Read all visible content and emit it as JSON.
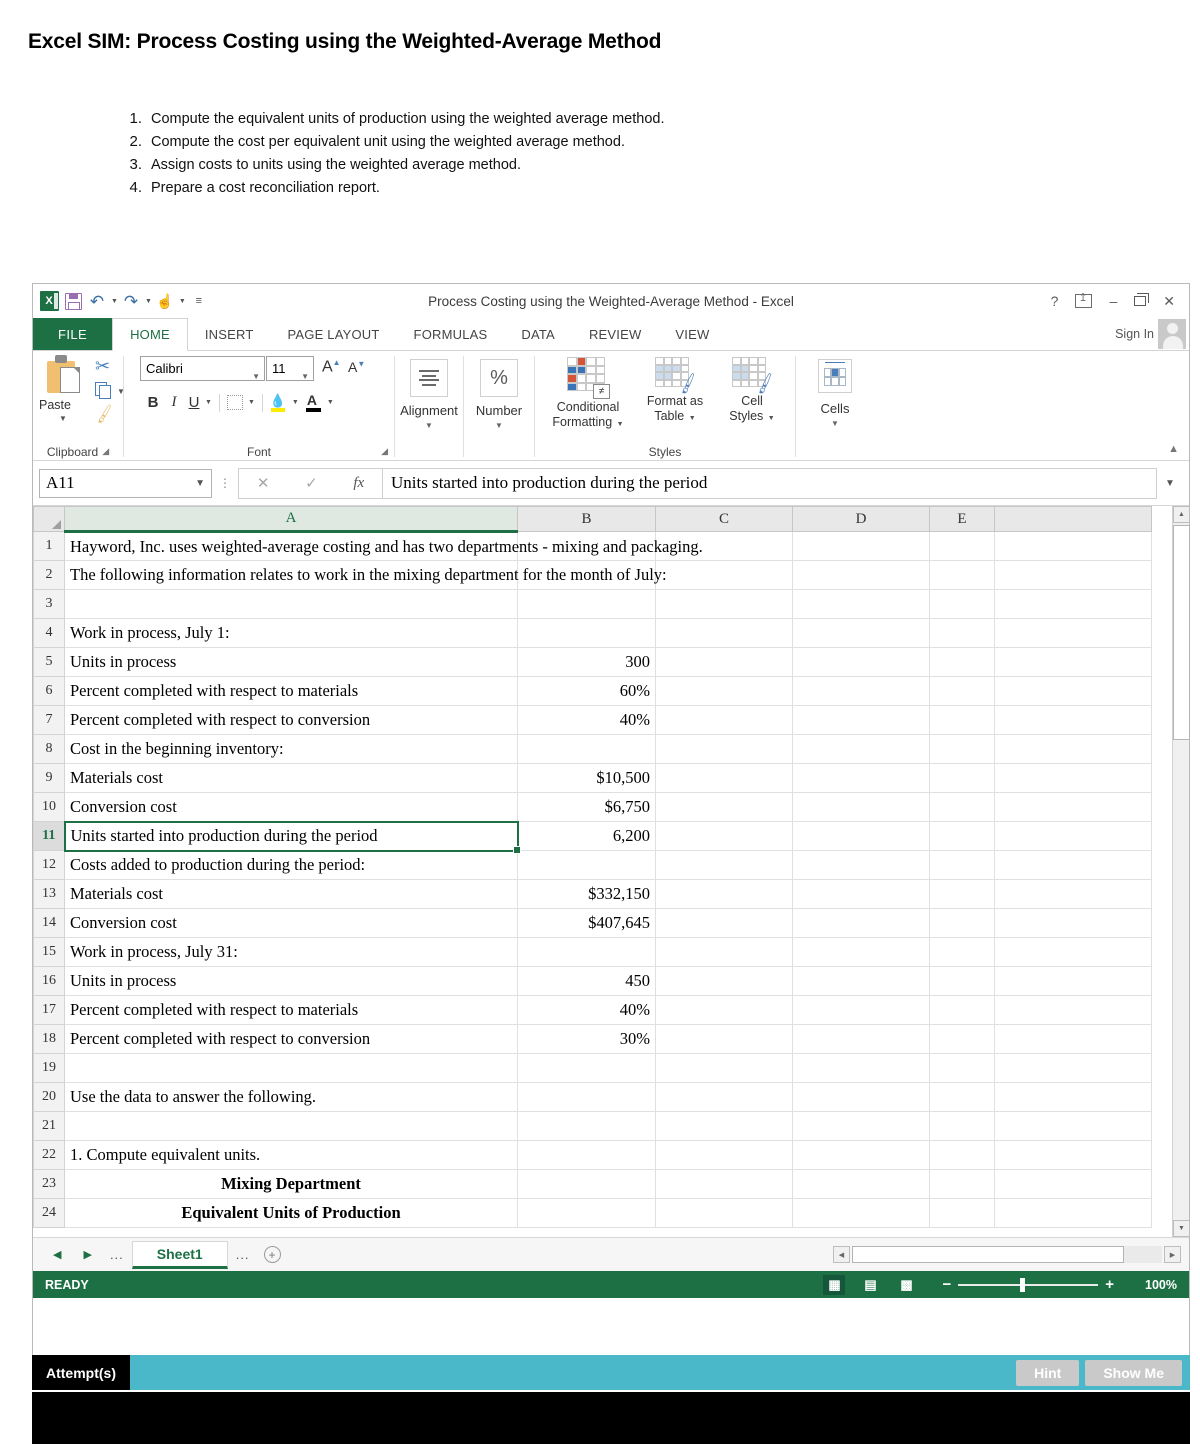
{
  "page": {
    "title": "Excel SIM: Process Costing using the Weighted-Average Method",
    "tasks": [
      {
        "num": "1.",
        "text": "Compute the equivalent units of production using the weighted average method."
      },
      {
        "num": "2.",
        "text": "Compute the cost per equivalent unit using the weighted average method."
      },
      {
        "num": "3.",
        "text": "Assign costs to units using the weighted average method."
      },
      {
        "num": "4.",
        "text": "Prepare a cost reconciliation report."
      }
    ]
  },
  "window": {
    "title": "Process Costing using the Weighted-Average Method - Excel",
    "quick_access": {
      "logo": "excel-logo",
      "save": "save-icon",
      "undo": "undo-icon",
      "redo": "redo-icon",
      "touch": "touch-mode-icon",
      "more": "more-icon"
    },
    "controls": {
      "help": "?",
      "ribbon_options": "ribbon-display-options-icon",
      "minimize": "–",
      "restore": "restore-icon",
      "close": "✕"
    },
    "sign_in": "Sign In"
  },
  "ribbon": {
    "tabs": [
      {
        "label": "FILE",
        "active": false,
        "is_file": true
      },
      {
        "label": "HOME",
        "active": true
      },
      {
        "label": "INSERT",
        "active": false
      },
      {
        "label": "PAGE LAYOUT",
        "active": false
      },
      {
        "label": "FORMULAS",
        "active": false
      },
      {
        "label": "DATA",
        "active": false
      },
      {
        "label": "REVIEW",
        "active": false
      },
      {
        "label": "VIEW",
        "active": false
      }
    ],
    "groups": {
      "clipboard": {
        "label": "Clipboard",
        "paste": "Paste",
        "cut": "scissors-icon",
        "copy": "copy-icon",
        "format_painter": "format-painter-icon"
      },
      "font": {
        "label": "Font",
        "font_name": "Calibri",
        "font_size": "11",
        "grow_font": "A",
        "shrink_font": "A",
        "bold": "B",
        "italic": "I",
        "underline": "U",
        "borders": "borders-icon",
        "fill_color": "fill-color-icon",
        "font_color": "A"
      },
      "alignment": {
        "label": "Alignment",
        "icon": "align-icon"
      },
      "number": {
        "label": "Number",
        "icon": "percent-icon",
        "symbol": "%"
      },
      "styles": {
        "label": "Styles",
        "conditional_formatting": "Conditional Formatting",
        "conditional_line1": "Conditional",
        "conditional_line2": "Formatting",
        "format_as_table_line1": "Format as",
        "format_as_table_line2": "Table",
        "cell_styles_line1": "Cell",
        "cell_styles_line2": "Styles",
        "badge": "≠"
      },
      "cells": {
        "label": "Cells",
        "name": "Cells"
      }
    }
  },
  "formula_bar": {
    "name_box": "A11",
    "cancel": "✕",
    "enter": "✓",
    "function": "fx",
    "content": "Units started into production during the period"
  },
  "grid": {
    "columns": [
      "A",
      "B",
      "C",
      "D",
      "E",
      ""
    ],
    "selected_column": "A",
    "selected_row": "11",
    "selected_cell": "A11",
    "rows": [
      {
        "n": "1",
        "a": "Hayword, Inc. uses weighted-average costing and has two departments - mixing and packaging.",
        "b": "",
        "spill": true
      },
      {
        "n": "2",
        "a": "The following information relates to work in the mixing department for the month of July:",
        "b": "",
        "spill": true
      },
      {
        "n": "3",
        "a": "",
        "b": ""
      },
      {
        "n": "4",
        "a": "Work in process, July 1:",
        "b": ""
      },
      {
        "n": "5",
        "a": "Units in process",
        "b": "300",
        "indent": 1
      },
      {
        "n": "6",
        "a": "Percent completed with respect to materials",
        "b": "60%",
        "indent": 1
      },
      {
        "n": "7",
        "a": "Percent completed with respect to conversion",
        "b": "40%",
        "indent": 1
      },
      {
        "n": "8",
        "a": "Cost in the beginning inventory:",
        "b": "",
        "indent": 1
      },
      {
        "n": "9",
        "a": "Materials cost",
        "b": "$10,500",
        "indent": 2
      },
      {
        "n": "10",
        "a": "Conversion cost",
        "b": "$6,750",
        "indent": 2
      },
      {
        "n": "11",
        "a": "Units started into production during the period",
        "b": "6,200",
        "selected": true
      },
      {
        "n": "12",
        "a": "Costs added to production during the period:",
        "b": ""
      },
      {
        "n": "13",
        "a": "Materials cost",
        "b": "$332,150",
        "indent": 1
      },
      {
        "n": "14",
        "a": "Conversion cost",
        "b": "$407,645",
        "indent": 1
      },
      {
        "n": "15",
        "a": "Work in process, July 31:",
        "b": ""
      },
      {
        "n": "16",
        "a": "Units in process",
        "b": "450",
        "indent": 1
      },
      {
        "n": "17",
        "a": "Percent completed with respect to materials",
        "b": "40%",
        "indent": 1
      },
      {
        "n": "18",
        "a": "Percent completed with respect to conversion",
        "b": "30%",
        "indent": 1
      },
      {
        "n": "19",
        "a": "",
        "b": ""
      },
      {
        "n": "20",
        "a": "Use the data to answer the following.",
        "b": ""
      },
      {
        "n": "21",
        "a": "",
        "b": ""
      },
      {
        "n": "22",
        "a": "1. Compute equivalent units.",
        "b": ""
      },
      {
        "n": "23",
        "a": "Mixing Department",
        "b": "",
        "center": true
      },
      {
        "n": "24",
        "a": "Equivalent Units of Production",
        "b": "",
        "center": true
      }
    ]
  },
  "sheet_tabs": {
    "first": "◀",
    "next": "▶",
    "left_dots": "...",
    "right_dots": "...",
    "active_sheet": "Sheet1",
    "add_sheet": "+"
  },
  "status_bar": {
    "state": "READY",
    "views": [
      "normal-view-icon",
      "page-layout-view-icon",
      "page-break-preview-icon"
    ],
    "zoom_out": "−",
    "zoom_in": "+",
    "zoom_level": "100%"
  },
  "attempt_bar": {
    "label": "Attempt(s)",
    "hint_button": "Hint",
    "show_me_button": "Show Me"
  }
}
